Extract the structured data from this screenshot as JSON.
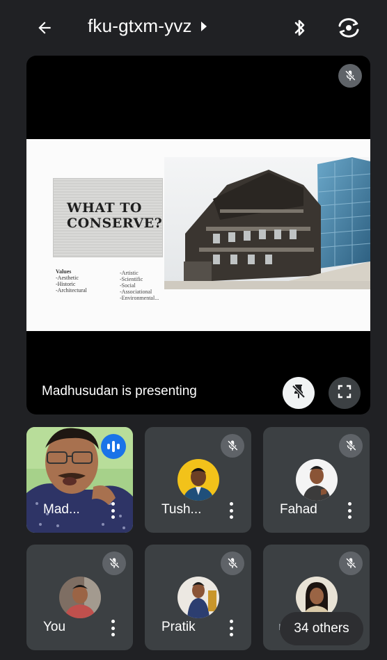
{
  "meeting": {
    "code": "fku-gtxm-yvz"
  },
  "presentation": {
    "label": "Madhusudan is presenting",
    "slide": {
      "heading_line1": "WHAT TO",
      "heading_line2": "CONSERVE?",
      "values_title": "Values",
      "values_left": [
        "-Aesthetic",
        "-Historic",
        "-Architectural"
      ],
      "values_right": [
        "-Artistic",
        "-Scientific",
        "-Social",
        "-Associational",
        "-Environmental..."
      ]
    }
  },
  "participants": [
    {
      "name": "Mad...",
      "speaking": true
    },
    {
      "name": "Tush...",
      "muted": true
    },
    {
      "name": "Fahad",
      "muted": true
    },
    {
      "name": "You",
      "muted": true
    },
    {
      "name": "Pratik",
      "muted": true
    },
    {
      "name": "ri",
      "muted": true
    }
  ],
  "others_label": "34 others",
  "colors": {
    "background": "#202124",
    "tile": "#3c4043",
    "accent_speaking": "#1a73e8"
  },
  "icons": [
    "back-arrow-icon",
    "caret-right-icon",
    "bluetooth-icon",
    "switch-camera-icon",
    "mic-off-icon",
    "unpin-icon",
    "fullscreen-icon",
    "speaking-indicator-icon",
    "more-vert-icon"
  ]
}
